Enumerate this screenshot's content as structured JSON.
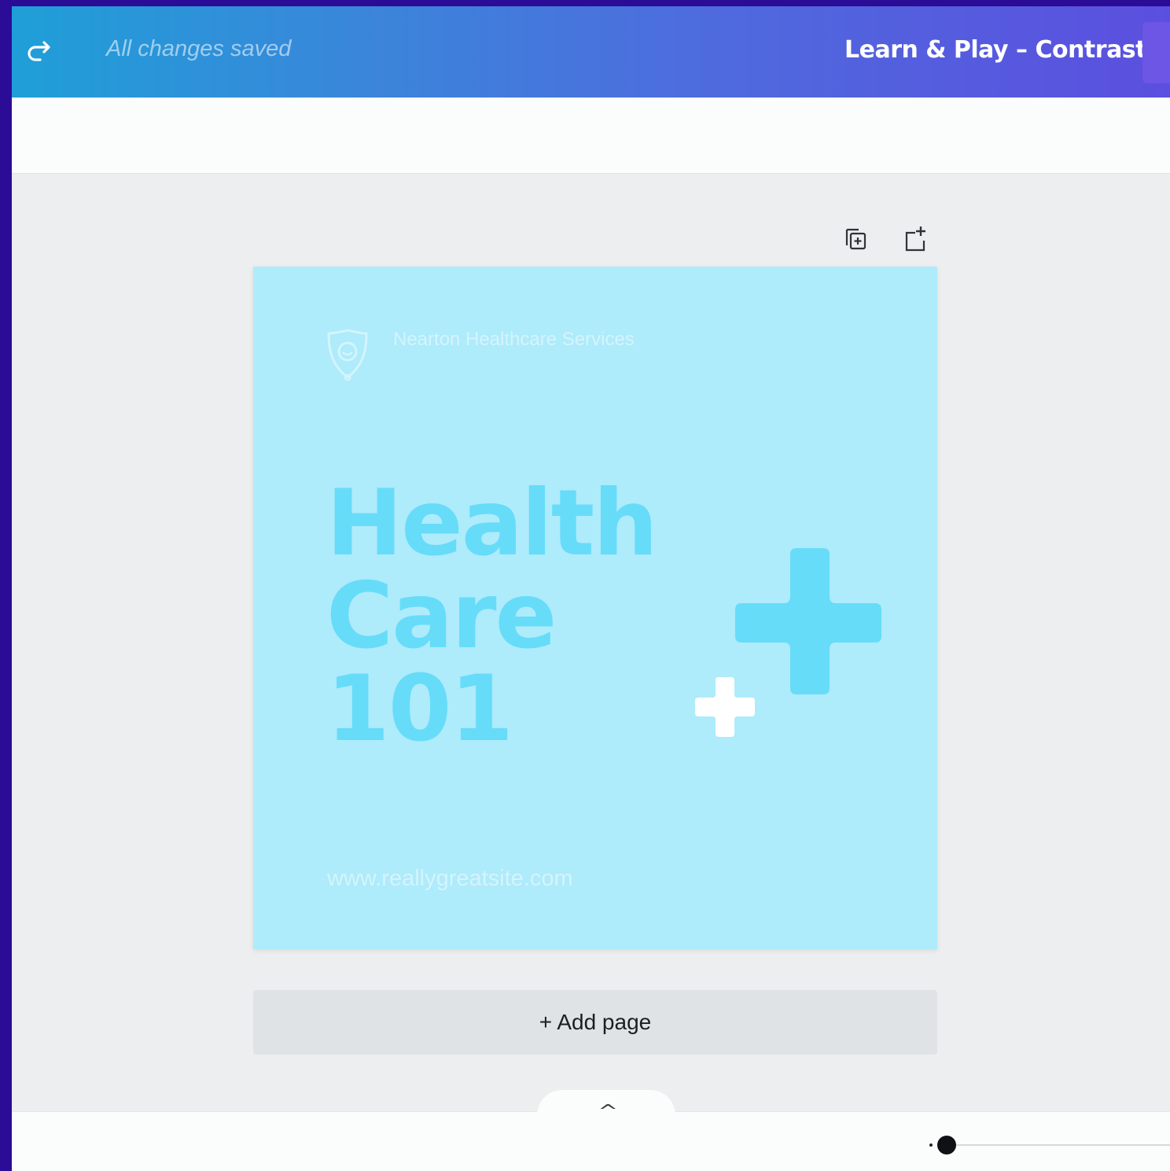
{
  "header": {
    "save_status": "All changes saved",
    "document_title": "Learn & Play – Contrast"
  },
  "design": {
    "brand_name": "Nearton Healthcare Services",
    "headline": "Health\nCare\n101",
    "website": "www.reallygreatsite.com",
    "colors": {
      "background": "#aeebfb",
      "headline": "#66dcf9",
      "big_cross": "#66dcf9",
      "small_cross": "#ffffff",
      "light_text": "#d4f4fd"
    }
  },
  "page_actions": {
    "duplicate_icon": "duplicate-page-icon",
    "add_icon": "add-page-icon"
  },
  "add_page_label": "+ Add page",
  "footer": {
    "chevron": "^",
    "zoom_level": 0.0
  }
}
